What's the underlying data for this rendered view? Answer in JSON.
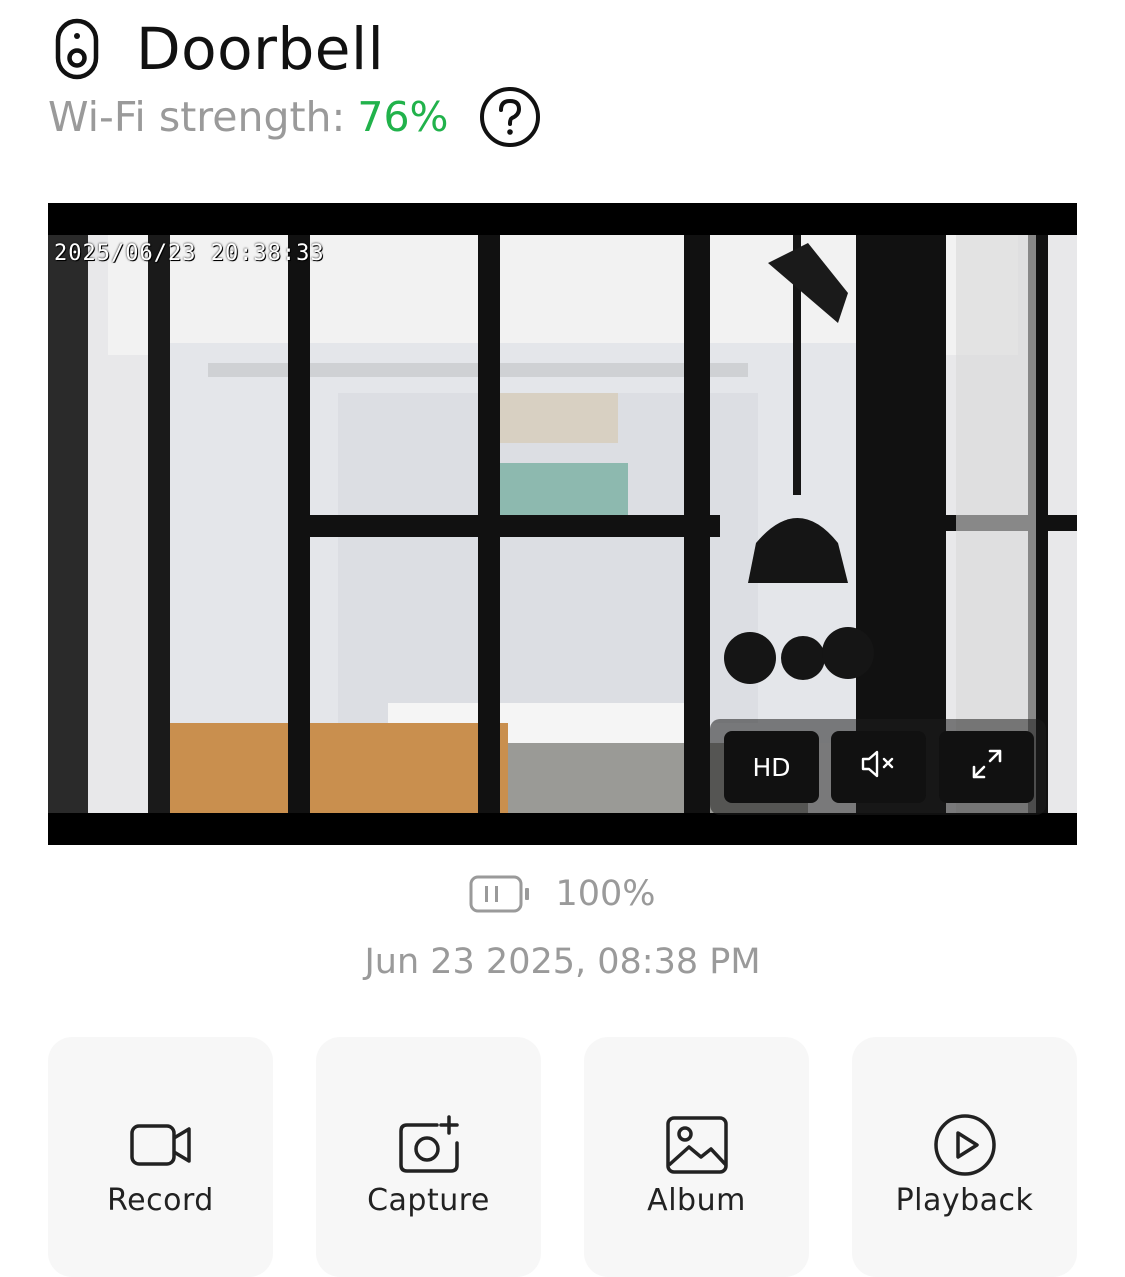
{
  "header": {
    "title": "Doorbell",
    "device_icon": "doorbell-icon"
  },
  "wifi": {
    "label": "Wi-Fi strength:",
    "value": "76%",
    "value_color": "#21b24b",
    "help_icon": "help-icon"
  },
  "video": {
    "timestamp": "2025/06/23 20:38:33",
    "controls": {
      "hd_label": "HD",
      "mute_icon": "mute-icon",
      "fullscreen_icon": "fullscreen-icon"
    }
  },
  "status": {
    "battery_icon": "battery-icon",
    "battery": "100%",
    "datetime": "Jun 23 2025, 08:38 PM"
  },
  "actions": [
    {
      "label": "Record",
      "icon": "video-camera-icon"
    },
    {
      "label": "Capture",
      "icon": "camera-plus-icon"
    },
    {
      "label": "Album",
      "icon": "image-icon"
    },
    {
      "label": "Playback",
      "icon": "play-circle-icon"
    }
  ]
}
